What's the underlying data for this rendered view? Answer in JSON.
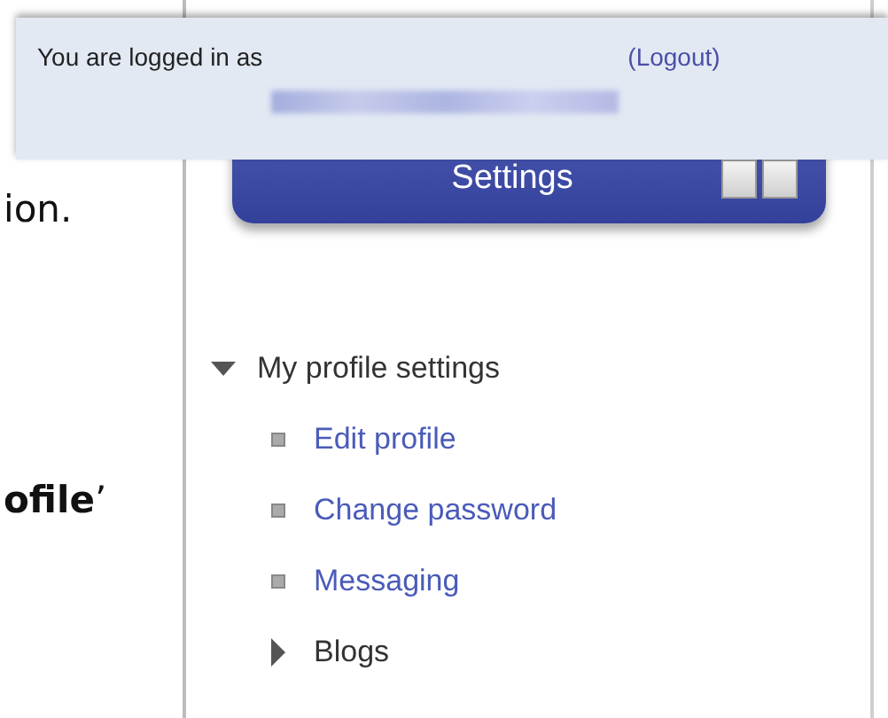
{
  "banner": {
    "login_text": "You are logged in as",
    "logout_link": "(Logout)"
  },
  "document": {
    "lines": [
      {
        "text": "ion."
      },
      {
        "text": "**ofile**’"
      }
    ]
  },
  "settings_block": {
    "title": "Settings",
    "tree": [
      {
        "label": "My profile settings",
        "kind": "branch",
        "expanded": true,
        "children": [
          {
            "label": "Edit profile",
            "kind": "link"
          },
          {
            "label": "Change password",
            "kind": "link"
          },
          {
            "label": "Messaging",
            "kind": "link"
          },
          {
            "label": "Blogs",
            "kind": "branch",
            "expanded": false
          }
        ]
      }
    ]
  }
}
